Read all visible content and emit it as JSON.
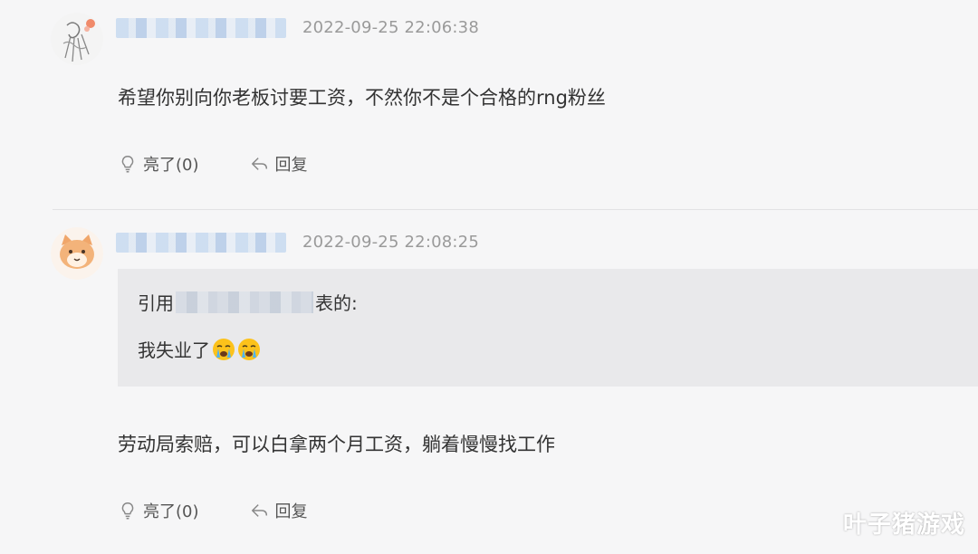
{
  "comments": [
    {
      "timestamp": "2022-09-25 22:06:38",
      "text": "希望你别向你老板讨要工资，不然你不是个合格的rng粉丝",
      "like_label": "亮了(0)",
      "reply_label": "回复"
    },
    {
      "timestamp": "2022-09-25 22:08:25",
      "quote": {
        "prefix": "引用",
        "suffix": "表的:",
        "text": "我失业了"
      },
      "text": "劳动局索赔，可以白拿两个月工资，躺着慢慢找工作",
      "like_label": "亮了(0)",
      "reply_label": "回复"
    }
  ],
  "watermark": "叶子猪游戏",
  "icons": {
    "avatar_1": "sketch-character-avatar-icon",
    "avatar_2": "cat-avatar-icon",
    "like": "lightbulb-icon",
    "reply": "reply-arrow-icon",
    "emoji": "crying-face-icon"
  }
}
